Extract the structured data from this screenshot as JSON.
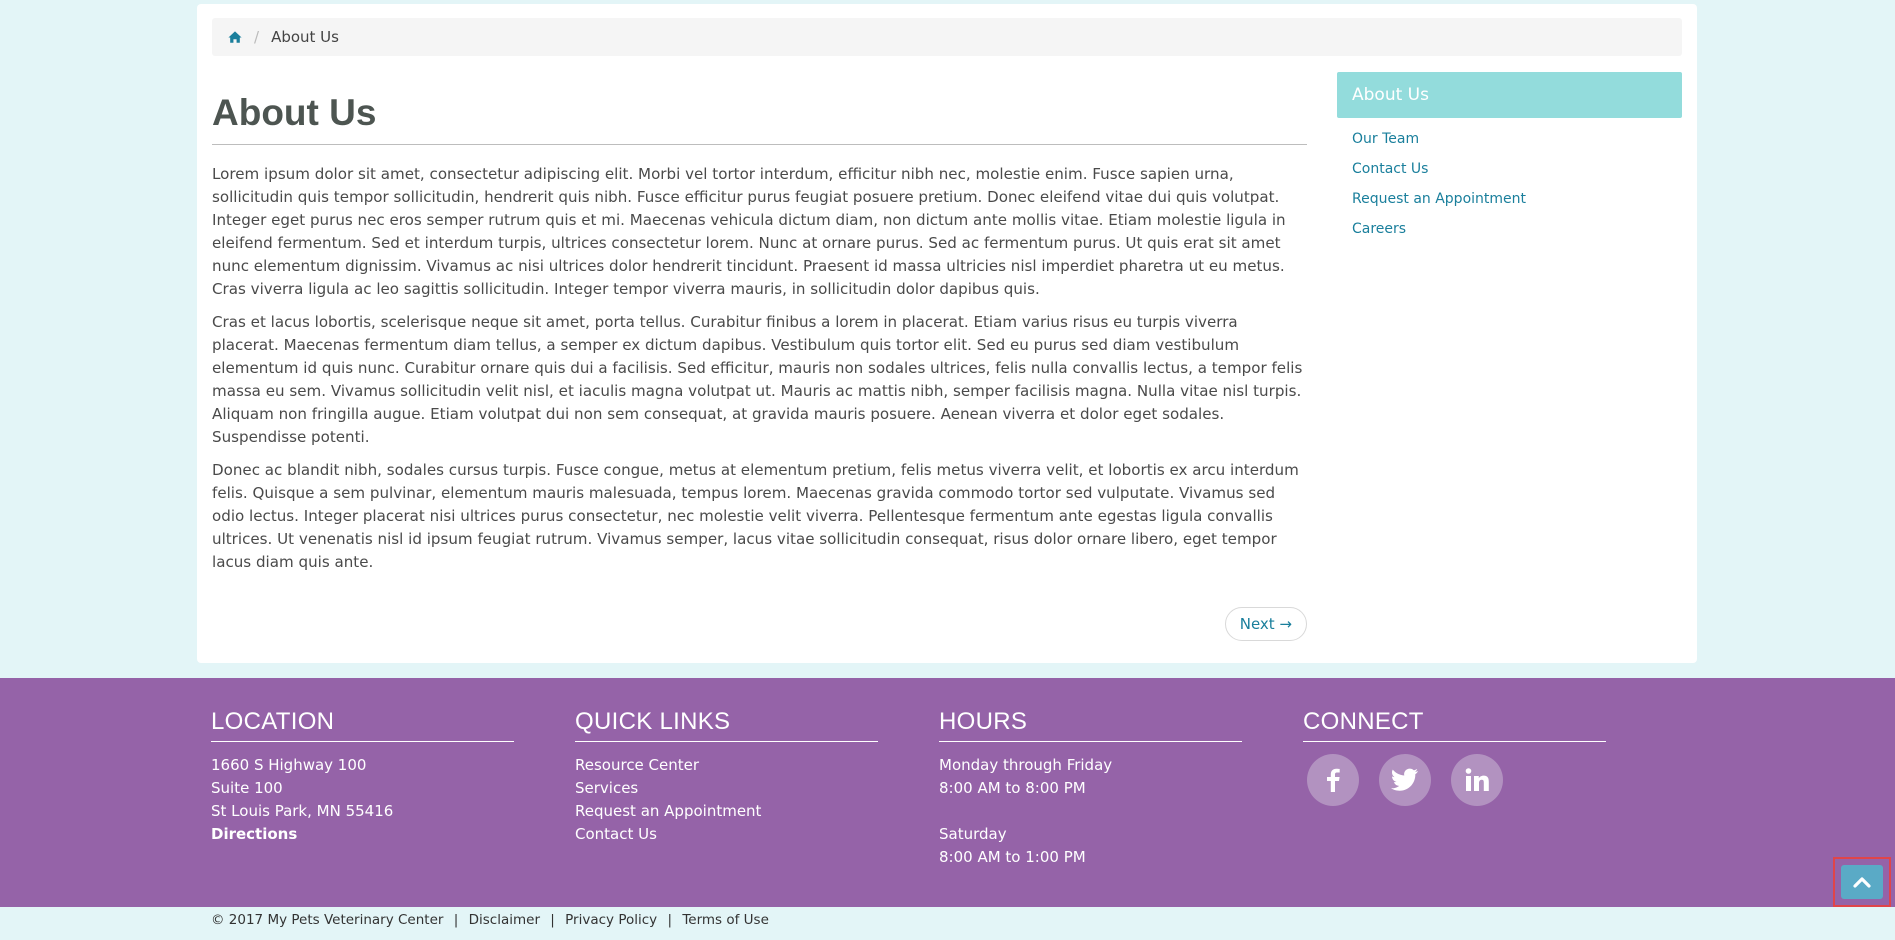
{
  "breadcrumb": {
    "home_icon": "home-icon",
    "separator": "/",
    "current": "About Us"
  },
  "page": {
    "title": "About Us",
    "paragraphs": [
      " Lorem ipsum dolor sit amet, consectetur adipiscing elit. Morbi vel tortor interdum, efficitur nibh nec, molestie enim. Fusce sapien urna, sollicitudin quis tempor sollicitudin, hendrerit quis nibh. Fusce efficitur purus feugiat posuere pretium. Donec eleifend vitae dui quis volutpat. Integer eget purus nec eros semper rutrum quis et mi. Maecenas vehicula dictum diam, non dictum ante mollis vitae. Etiam molestie ligula in eleifend fermentum. Sed et interdum turpis, ultrices consectetur lorem. Nunc at ornare purus. Sed ac fermentum purus. Ut quis erat sit amet nunc elementum dignissim. Vivamus ac nisi ultrices dolor hendrerit tincidunt. Praesent id massa ultricies nisl imperdiet pharetra ut eu metus. Cras viverra ligula ac leo sagittis sollicitudin. Integer tempor viverra mauris, in sollicitudin dolor dapibus quis.",
      "Cras et lacus lobortis, scelerisque neque sit amet, porta tellus. Curabitur finibus a lorem in placerat. Etiam varius risus eu turpis viverra placerat. Maecenas fermentum diam tellus, a semper ex dictum dapibus. Vestibulum quis tortor elit. Sed eu purus sed diam vestibulum elementum id quis nunc. Curabitur ornare quis dui a facilisis. Sed efficitur, mauris non sodales ultrices, felis nulla convallis lectus, a tempor felis massa eu sem. Vivamus sollicitudin velit nisl, et iaculis magna volutpat ut. Mauris ac mattis nibh, semper facilisis magna. Nulla vitae nisl turpis. Aliquam non fringilla augue. Etiam volutpat dui non sem consequat, at gravida mauris posuere. Aenean viverra et dolor eget sodales. Suspendisse potenti.",
      "Donec ac blandit nibh, sodales cursus turpis. Fusce congue, metus at elementum pretium, felis metus viverra velit, et lobortis ex arcu interdum felis. Quisque a sem pulvinar, elementum mauris malesuada, tempus lorem. Maecenas gravida commodo tortor sed vulputate. Vivamus sed odio lectus. Integer placerat nisi ultrices purus consectetur, nec molestie velit viverra. Pellentesque fermentum ante egestas ligula convallis ultrices. Ut venenatis nisl id ipsum feugiat rutrum. Vivamus semper, lacus vitae sollicitudin consequat, risus dolor ornare libero, eget tempor lacus diam quis ante."
    ],
    "next_label": "Next →"
  },
  "sidebar": {
    "heading": "About Us",
    "items": [
      "Our Team",
      "Contact Us",
      "Request an Appointment",
      "Careers"
    ]
  },
  "footer": {
    "location": {
      "heading": "LOCATION",
      "lines": [
        "1660 S Highway 100",
        "Suite 100",
        "St Louis Park, MN 55416"
      ],
      "directions": "Directions"
    },
    "quick_links": {
      "heading": "QUICK LINKS",
      "items": [
        "Resource Center",
        "Services",
        "Request an Appointment",
        "Contact Us"
      ]
    },
    "hours": {
      "heading": "HOURS",
      "weekday_label": "Monday through Friday",
      "weekday_hours": "8:00 AM to 8:00 PM",
      "saturday_label": "Saturday",
      "saturday_hours": "8:00 AM to 1:00 PM"
    },
    "connect": {
      "heading": "CONNECT",
      "icons": [
        "facebook-icon",
        "twitter-icon",
        "linkedin-icon"
      ]
    }
  },
  "bottom_bar": {
    "copyright": "© 2017  My Pets Veterinary Center",
    "separator": "|",
    "links": [
      "Disclaimer",
      "Privacy Policy",
      "Terms of Use"
    ]
  },
  "back_to_top": {
    "icon": "chevron-up-icon"
  },
  "colors": {
    "page_bg": "#e3f5f7",
    "link": "#1a7f9c",
    "sidebar_head": "#93dcdc",
    "footer_bg": "#9563a8",
    "social_circle": "#b292c0",
    "back_to_top": "#5aaac6"
  }
}
